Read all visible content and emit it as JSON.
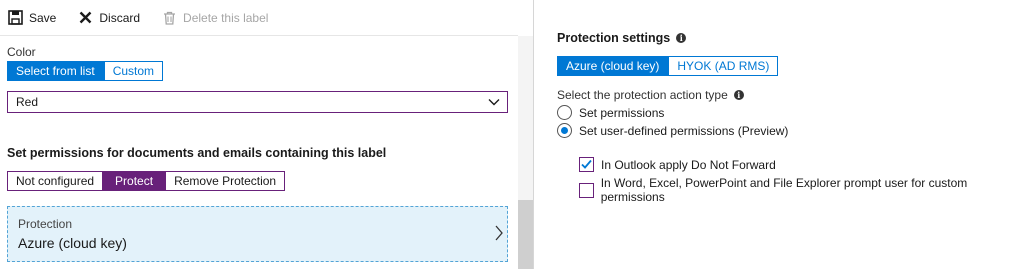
{
  "toolbar": {
    "save_label": "Save",
    "discard_label": "Discard",
    "delete_label": "Delete this label"
  },
  "color": {
    "label": "Color",
    "options": [
      "Select from list",
      "Custom"
    ],
    "active_index": 0,
    "selected_value": "Red"
  },
  "permissions": {
    "heading": "Set permissions for documents and emails containing this label",
    "options": [
      "Not configured",
      "Protect",
      "Remove Protection"
    ],
    "active_index": 1
  },
  "protection_card": {
    "title": "Protection",
    "value": "Azure (cloud key)"
  },
  "protection_settings": {
    "title": "Protection settings",
    "key_options": [
      "Azure (cloud key)",
      "HYOK (AD RMS)"
    ],
    "active_index": 0,
    "action_type_label": "Select the protection action type",
    "radios": [
      {
        "label": "Set permissions",
        "selected": false
      },
      {
        "label": "Set user-defined permissions (Preview)",
        "selected": true
      }
    ],
    "checkboxes": [
      {
        "label": "In Outlook apply Do Not Forward",
        "checked": true
      },
      {
        "label": "In Word, Excel, PowerPoint and File Explorer prompt user for custom permissions",
        "checked": false
      }
    ]
  },
  "colors": {
    "accent_blue": "#0078d4",
    "accent_purple": "#68217a",
    "card_bg": "#e3f2fa"
  },
  "icons": {
    "save": "save-icon",
    "discard": "close-icon",
    "delete": "trash-icon",
    "info": "info-icon",
    "dropdown": "chevron-down-icon",
    "card_nav": "chevron-right-icon"
  }
}
